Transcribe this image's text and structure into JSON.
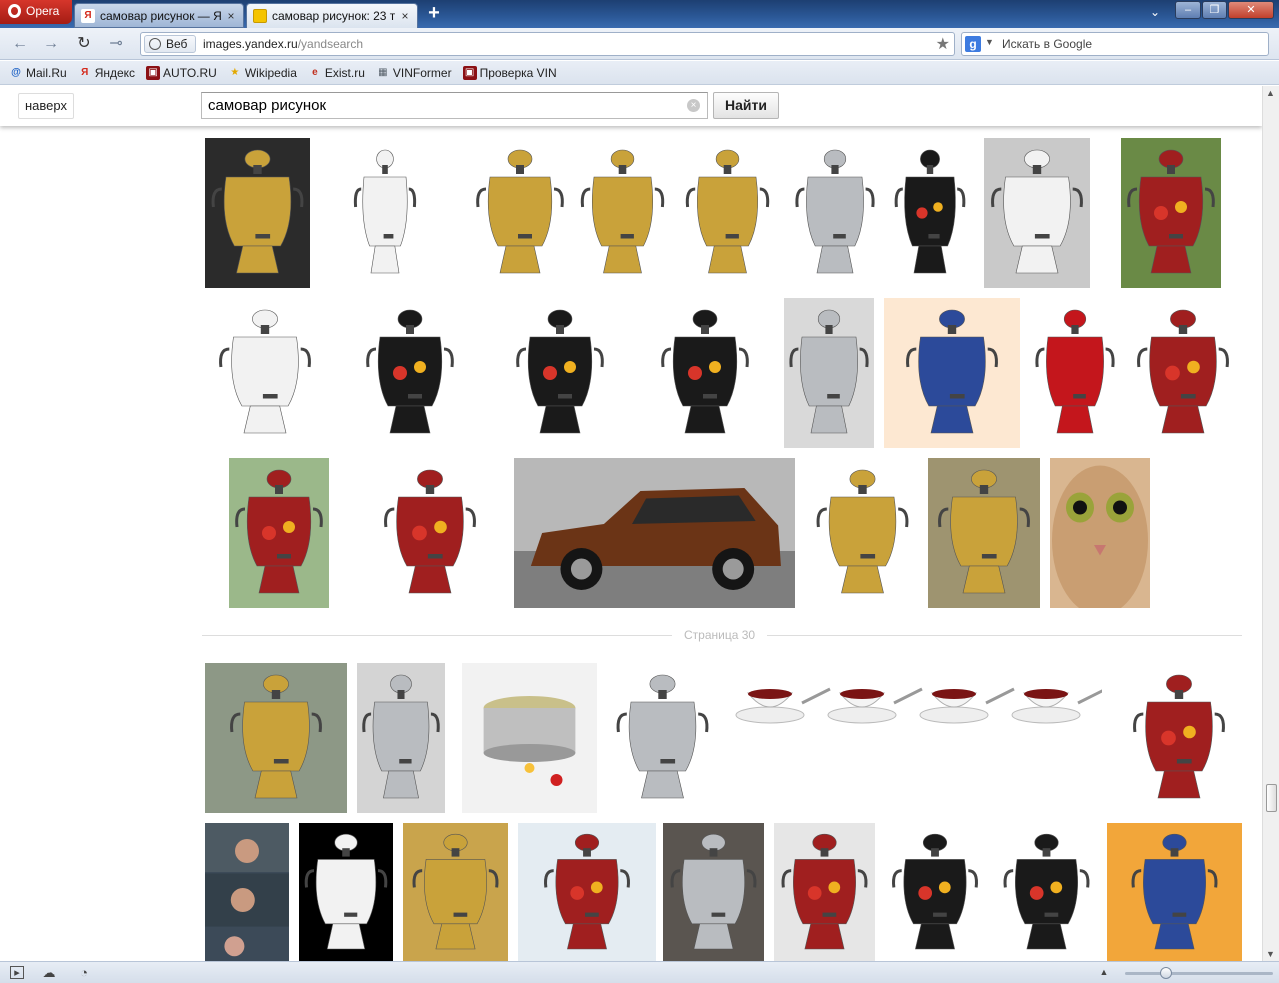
{
  "browser": {
    "opera_label": "Opera",
    "tabs": [
      {
        "title": "самовар рисунок — Я...",
        "close": "×"
      },
      {
        "title": "самовар рисунок: 23 т...",
        "close": "×"
      }
    ],
    "new_tab": "+",
    "tab_menu": "⌄",
    "window_buttons": {
      "minimize": "–",
      "maximize": "❐",
      "close": "✕"
    }
  },
  "nav": {
    "back": "←",
    "forward": "→",
    "reload": "↻",
    "key": "⊸",
    "web_label": "Веб",
    "url_domain": "images.yandex.ru",
    "url_path": "/yandsearch",
    "star": "★",
    "search_engine_icon": "g",
    "search_placeholder": "Искать в Google"
  },
  "bookmarks": [
    {
      "label": "Mail.Ru",
      "icon": "@",
      "color": "#1a5fc4"
    },
    {
      "label": "Яндекс",
      "icon": "Я",
      "color": "#d42a1c"
    },
    {
      "label": "AUTO.RU",
      "icon": "▣",
      "color": "#8b1014"
    },
    {
      "label": "Wikipedia",
      "icon": "★",
      "color": "#e2a800"
    },
    {
      "label": "Exist.ru",
      "icon": "e",
      "color": "#c0301f"
    },
    {
      "label": "VINFormer",
      "icon": "▦",
      "color": "#56606a"
    },
    {
      "label": "Проверка VIN",
      "icon": "▣",
      "color": "#8b1014"
    }
  ],
  "page": {
    "top_link": "наверх",
    "query": "самовар рисунок",
    "clear": "×",
    "find_button": "Найти",
    "page_separator": "Страница 30"
  },
  "status": {
    "icons": [
      "panel-toggle-icon",
      "cloud-icon",
      "speed-dial-icon"
    ]
  }
}
